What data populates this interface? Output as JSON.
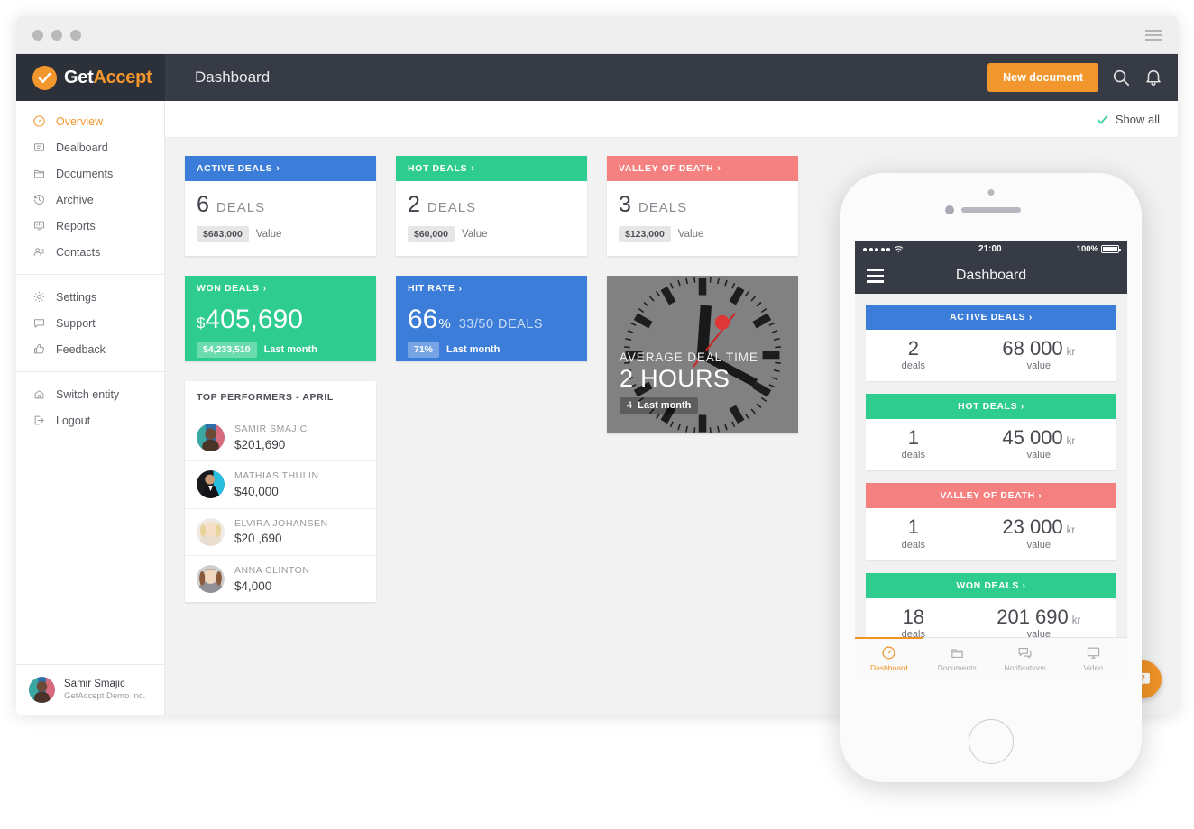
{
  "browser": {
    "menu_icon": "hamburger-icon",
    "traffic_lights": [
      "close",
      "minimize",
      "maximize"
    ]
  },
  "header": {
    "brand_get": "Get",
    "brand_accept": "Accept",
    "brand_mark_icon": "check-icon",
    "page_title": "Dashboard",
    "new_document_label": "New document",
    "search_icon": "search-icon",
    "notification_icon": "bell-icon",
    "accent_color": "#f2962e",
    "bar_color": "#363b45"
  },
  "sidebar": {
    "items": [
      {
        "label": "Overview",
        "icon": "speedometer-icon",
        "active": true
      },
      {
        "label": "Dealboard",
        "icon": "dealboard-icon",
        "active": false
      },
      {
        "label": "Documents",
        "icon": "folder-icon",
        "active": false
      },
      {
        "label": "Archive",
        "icon": "history-icon",
        "active": false
      },
      {
        "label": "Reports",
        "icon": "report-icon",
        "active": false
      },
      {
        "label": "Contacts",
        "icon": "contacts-icon",
        "active": false
      }
    ],
    "items2": [
      {
        "label": "Settings",
        "icon": "gear-icon"
      },
      {
        "label": "Support",
        "icon": "chat-icon"
      },
      {
        "label": "Feedback",
        "icon": "thumbs-up-icon"
      }
    ],
    "items3": [
      {
        "label": "Switch entity",
        "icon": "switch-icon"
      },
      {
        "label": "Logout",
        "icon": "logout-icon"
      }
    ],
    "user": {
      "name": "Samir Smajic",
      "company": "GetAccept Demo Inc.",
      "avatar": "user-avatar"
    }
  },
  "main": {
    "show_all_label": "Show all",
    "show_all_icon": "check-icon",
    "help_button_icon": "question-bubble-icon",
    "kpi_cards": [
      {
        "title": "ACTIVE DEALS",
        "color": "#3b7dd8",
        "count": "6",
        "unit": "DEALS",
        "chip": "$683,000",
        "sub_label": "Value"
      },
      {
        "title": "HOT DEALS",
        "color": "#2ecc8f",
        "count": "2",
        "unit": "DEALS",
        "chip": "$60,000",
        "sub_label": "Value"
      },
      {
        "title": "VALLEY OF DEATH",
        "color": "#f58080",
        "count": "3",
        "unit": "DEALS",
        "chip": "$123,000",
        "sub_label": "Value"
      }
    ],
    "won_deals": {
      "title": "WON DEALS",
      "color": "#2ecc8f",
      "currency": "$",
      "value": "405,690",
      "chip": "$4,233,510",
      "sub_label": "Last month"
    },
    "hit_rate": {
      "title": "HIT RATE",
      "color": "#3b7dd8",
      "value": "66",
      "pct": "%",
      "extra": "33/50 DEALS",
      "chip": "71%",
      "sub_label": "Last month"
    },
    "clock_card": {
      "label": "AVERAGE DEAL TIME",
      "value": "2 HOURS",
      "sub_number": "4",
      "sub_label": "Last month"
    },
    "top_performers": {
      "title": "TOP PERFORMERS - APRIL",
      "rows": [
        {
          "name": "SAMIR SMAJIC",
          "amount": "$201,690"
        },
        {
          "name": "MATHIAS THULIN",
          "amount": "$40,000"
        },
        {
          "name": "ELVIRA JOHANSEN",
          "amount": "$20 ,690"
        },
        {
          "name": "ANNA CLINTON",
          "amount": "$4,000"
        }
      ]
    }
  },
  "phone": {
    "status": {
      "time": "21:00",
      "battery": "100%",
      "signal_icon": "signal-dots-icon",
      "wifi_icon": "wifi-icon"
    },
    "nav": {
      "title": "Dashboard",
      "menu_icon": "hamburger-icon"
    },
    "cards": [
      {
        "title": "ACTIVE DEALS",
        "color": "#3b7dd8",
        "count": "2",
        "count_label": "deals",
        "value": "68 000",
        "currency": "kr",
        "value_label": "value"
      },
      {
        "title": "HOT DEALS",
        "color": "#2ecc8f",
        "count": "1",
        "count_label": "deals",
        "value": "45 000",
        "currency": "kr",
        "value_label": "value"
      },
      {
        "title": "VALLEY OF DEATH",
        "color": "#f58080",
        "count": "1",
        "count_label": "deals",
        "value": "23 000",
        "currency": "kr",
        "value_label": "value"
      },
      {
        "title": "WON DEALS",
        "color": "#2ecc8f",
        "count": "18",
        "count_label": "deals",
        "value": "201 690",
        "currency": "kr",
        "value_label": "value"
      }
    ],
    "tabs": [
      {
        "label": "Dashboard",
        "icon": "speedometer-icon",
        "active": true
      },
      {
        "label": "Documents",
        "icon": "folder-icon",
        "active": false
      },
      {
        "label": "Notifications",
        "icon": "chat-icon",
        "active": false
      },
      {
        "label": "Video",
        "icon": "monitor-icon",
        "active": false
      }
    ]
  }
}
